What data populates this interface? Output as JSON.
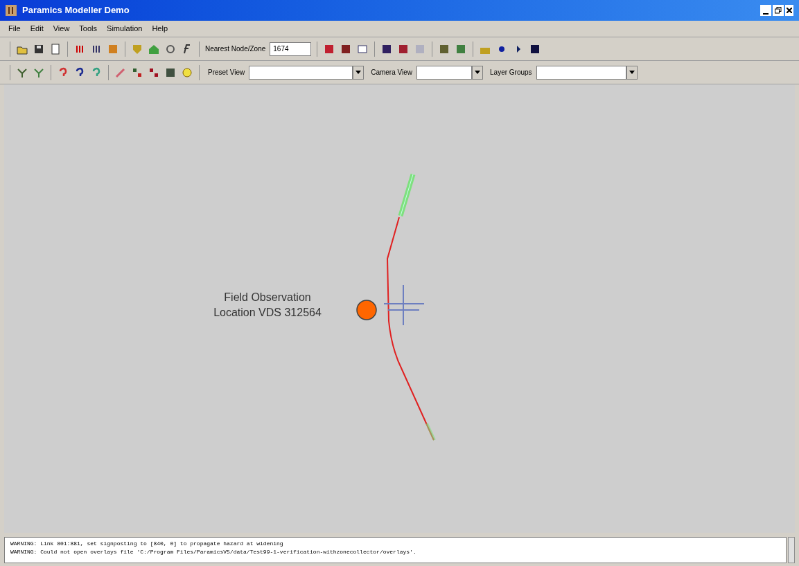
{
  "window": {
    "title": "Paramics Modeller Demo"
  },
  "menu": [
    {
      "label": "File"
    },
    {
      "label": "Edit"
    },
    {
      "label": "View"
    },
    {
      "label": "Tools"
    },
    {
      "label": "Simulation"
    },
    {
      "label": "Help"
    }
  ],
  "toolbar": {
    "nearest_label": "Nearest Node/Zone",
    "nearest_value": "1674"
  },
  "view_bar": [
    {
      "label": "Preset View"
    },
    {
      "label": "Camera View"
    },
    {
      "label": "Layer Groups"
    }
  ],
  "canvas": {
    "label_lines": [
      "Field Observation",
      "Location VDS 312564"
    ]
  },
  "log": [
    "WARNING: Link 801:881, set signposting to [840, 0] to propagate hazard at widening",
    "WARNING: Could not open overlays file 'C:/Program Files/ParamicsV5/data/Test99-1-verification-withzonecollector/overlays'."
  ]
}
